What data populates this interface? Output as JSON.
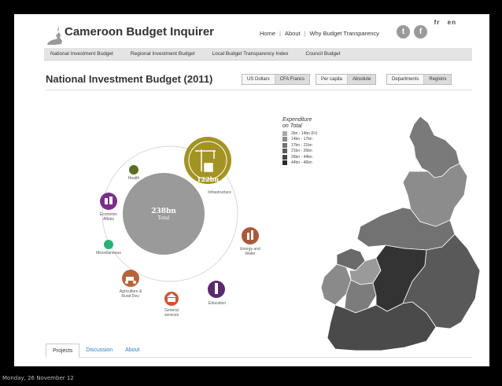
{
  "app": {
    "title": "Cameroon Budget Inquirer"
  },
  "language": {
    "options": [
      "fr",
      "en"
    ]
  },
  "top_nav": {
    "home": "Home",
    "about": "About",
    "why": "Why Budget Transparency"
  },
  "social": {
    "twitter": "twitter-icon",
    "facebook": "facebook-icon"
  },
  "sub_nav": {
    "items": [
      "National Investment Budget",
      "Regional Investment Budget",
      "Local Budget Transparency Index",
      "Council Budget"
    ]
  },
  "page": {
    "title": "National Investment Budget (2011)"
  },
  "controls": {
    "currency": [
      "US Dollars",
      "CFA Francs"
    ],
    "currency_active": "CFA Francs",
    "mode": [
      "Per capita",
      "Absolute"
    ],
    "mode_active": "Absolute",
    "view": [
      "Departments",
      "Regions"
    ],
    "view_active": "Regions"
  },
  "bubbles": {
    "total": {
      "amount": "238bn",
      "label": "Total"
    },
    "infrastructure": {
      "amount": "122bn",
      "label": "Infrastructure",
      "icon": "crane-icon"
    },
    "health": {
      "label": "Health"
    },
    "economic_affairs": {
      "label": "Economic\nAffairs",
      "icon": "economy-icon"
    },
    "miscellaneous": {
      "label": "Miscellaneous"
    },
    "agriculture": {
      "label": "Agriculture &\nRural Dev.",
      "icon": "agriculture-icon"
    },
    "general_services": {
      "label": "General\nservices",
      "icon": "building-icon"
    },
    "education": {
      "label": "Education",
      "icon": "education-icon"
    },
    "energy_water": {
      "label": "Energy and\nWater",
      "icon": "energy-icon"
    }
  },
  "colors": {
    "infrastructure": "#a39322",
    "health": "#5b6e1f",
    "economic_affairs": "#7a2f8a",
    "miscellaneous": "#2bb07a",
    "agriculture": "#b5643a",
    "general_services": "#c9573a",
    "education": "#5b2a6e",
    "energy_water": "#a85a3a",
    "total": "#9a9a9a"
  },
  "legend": {
    "title": "Expenditure\non Total",
    "items": [
      {
        "label": "2bn - 14bn (Fr)",
        "color": "#a8a8a8"
      },
      {
        "label": "14bn - 17bn",
        "color": "#8c8c8c"
      },
      {
        "label": "17bn - 21bn",
        "color": "#737373"
      },
      {
        "label": "21bn - 26bn",
        "color": "#5c5c5c"
      },
      {
        "label": "26bn - 44bn",
        "color": "#444444"
      },
      {
        "label": "44bn - 46bn",
        "color": "#2b2b2b"
      }
    ]
  },
  "bottom_tabs": {
    "items": [
      "Projects",
      "Discussion",
      "About"
    ],
    "active": "Projects"
  },
  "os_status": "Monday, 26 November 12"
}
